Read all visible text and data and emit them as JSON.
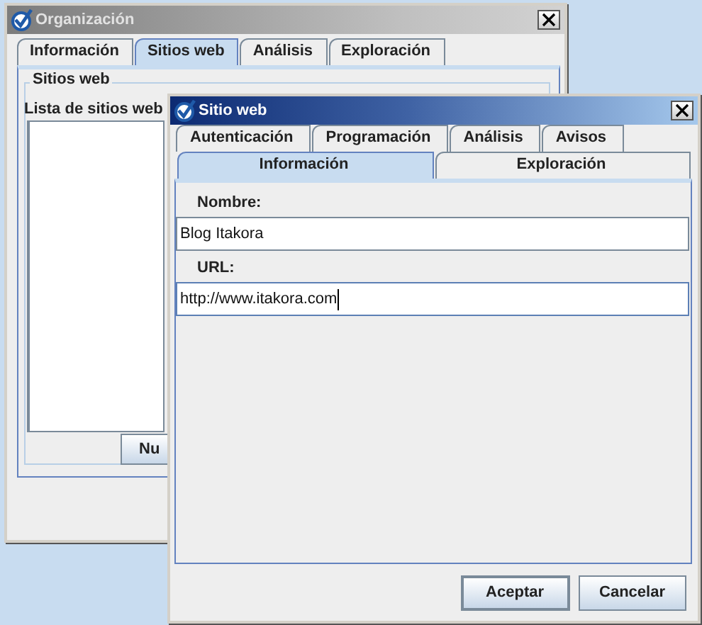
{
  "main_window": {
    "title": "Organización",
    "active": false,
    "tabs": [
      {
        "label": "Información",
        "selected": false
      },
      {
        "label": "Sitios web",
        "selected": true
      },
      {
        "label": "Análisis",
        "selected": false
      },
      {
        "label": "Exploración",
        "selected": false
      }
    ],
    "group_title": "Sitios web",
    "list_label": "Lista de sitios web",
    "button": "Nu"
  },
  "dialog": {
    "title": "Sitio web",
    "active": true,
    "tab_rows": [
      {
        "tabs": [
          {
            "label": "Autenticación",
            "selected": false
          },
          {
            "label": "Programación",
            "selected": false
          },
          {
            "label": "Análisis",
            "selected": false
          },
          {
            "label": "Avisos",
            "selected": false
          }
        ]
      },
      {
        "tabs": [
          {
            "label": "Información",
            "selected": true
          },
          {
            "label": "Exploración",
            "selected": false
          }
        ]
      }
    ],
    "fields": [
      {
        "label": "Nombre:",
        "value": "Blog Itakora",
        "focused": false
      },
      {
        "label": "URL:",
        "value": "http://www.itakora.com",
        "focused": true
      }
    ],
    "buttons": [
      {
        "label": "Aceptar",
        "default": true
      },
      {
        "label": "Cancelar",
        "default": false
      }
    ]
  }
}
